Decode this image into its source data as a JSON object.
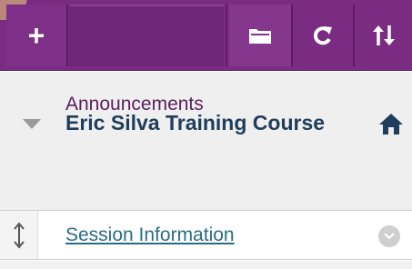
{
  "toolbar": {
    "add_icon": "plus-icon",
    "folder_icon": "folder-icon",
    "refresh_icon": "refresh-icon",
    "sort_icon": "sort-icon",
    "colors": {
      "background": "#7a2b82",
      "icon": "#ffffff"
    }
  },
  "course": {
    "title": "Eric Silva Training Course",
    "expand_icon": "caret-down-icon",
    "home_icon": "home-icon"
  },
  "menu": {
    "items": [
      {
        "label": "Announcements"
      },
      {
        "label": "Session Information"
      }
    ]
  },
  "colors": {
    "title": "#1f3d5c",
    "announcements": "#5c1f5e",
    "link": "#2b6d86"
  }
}
